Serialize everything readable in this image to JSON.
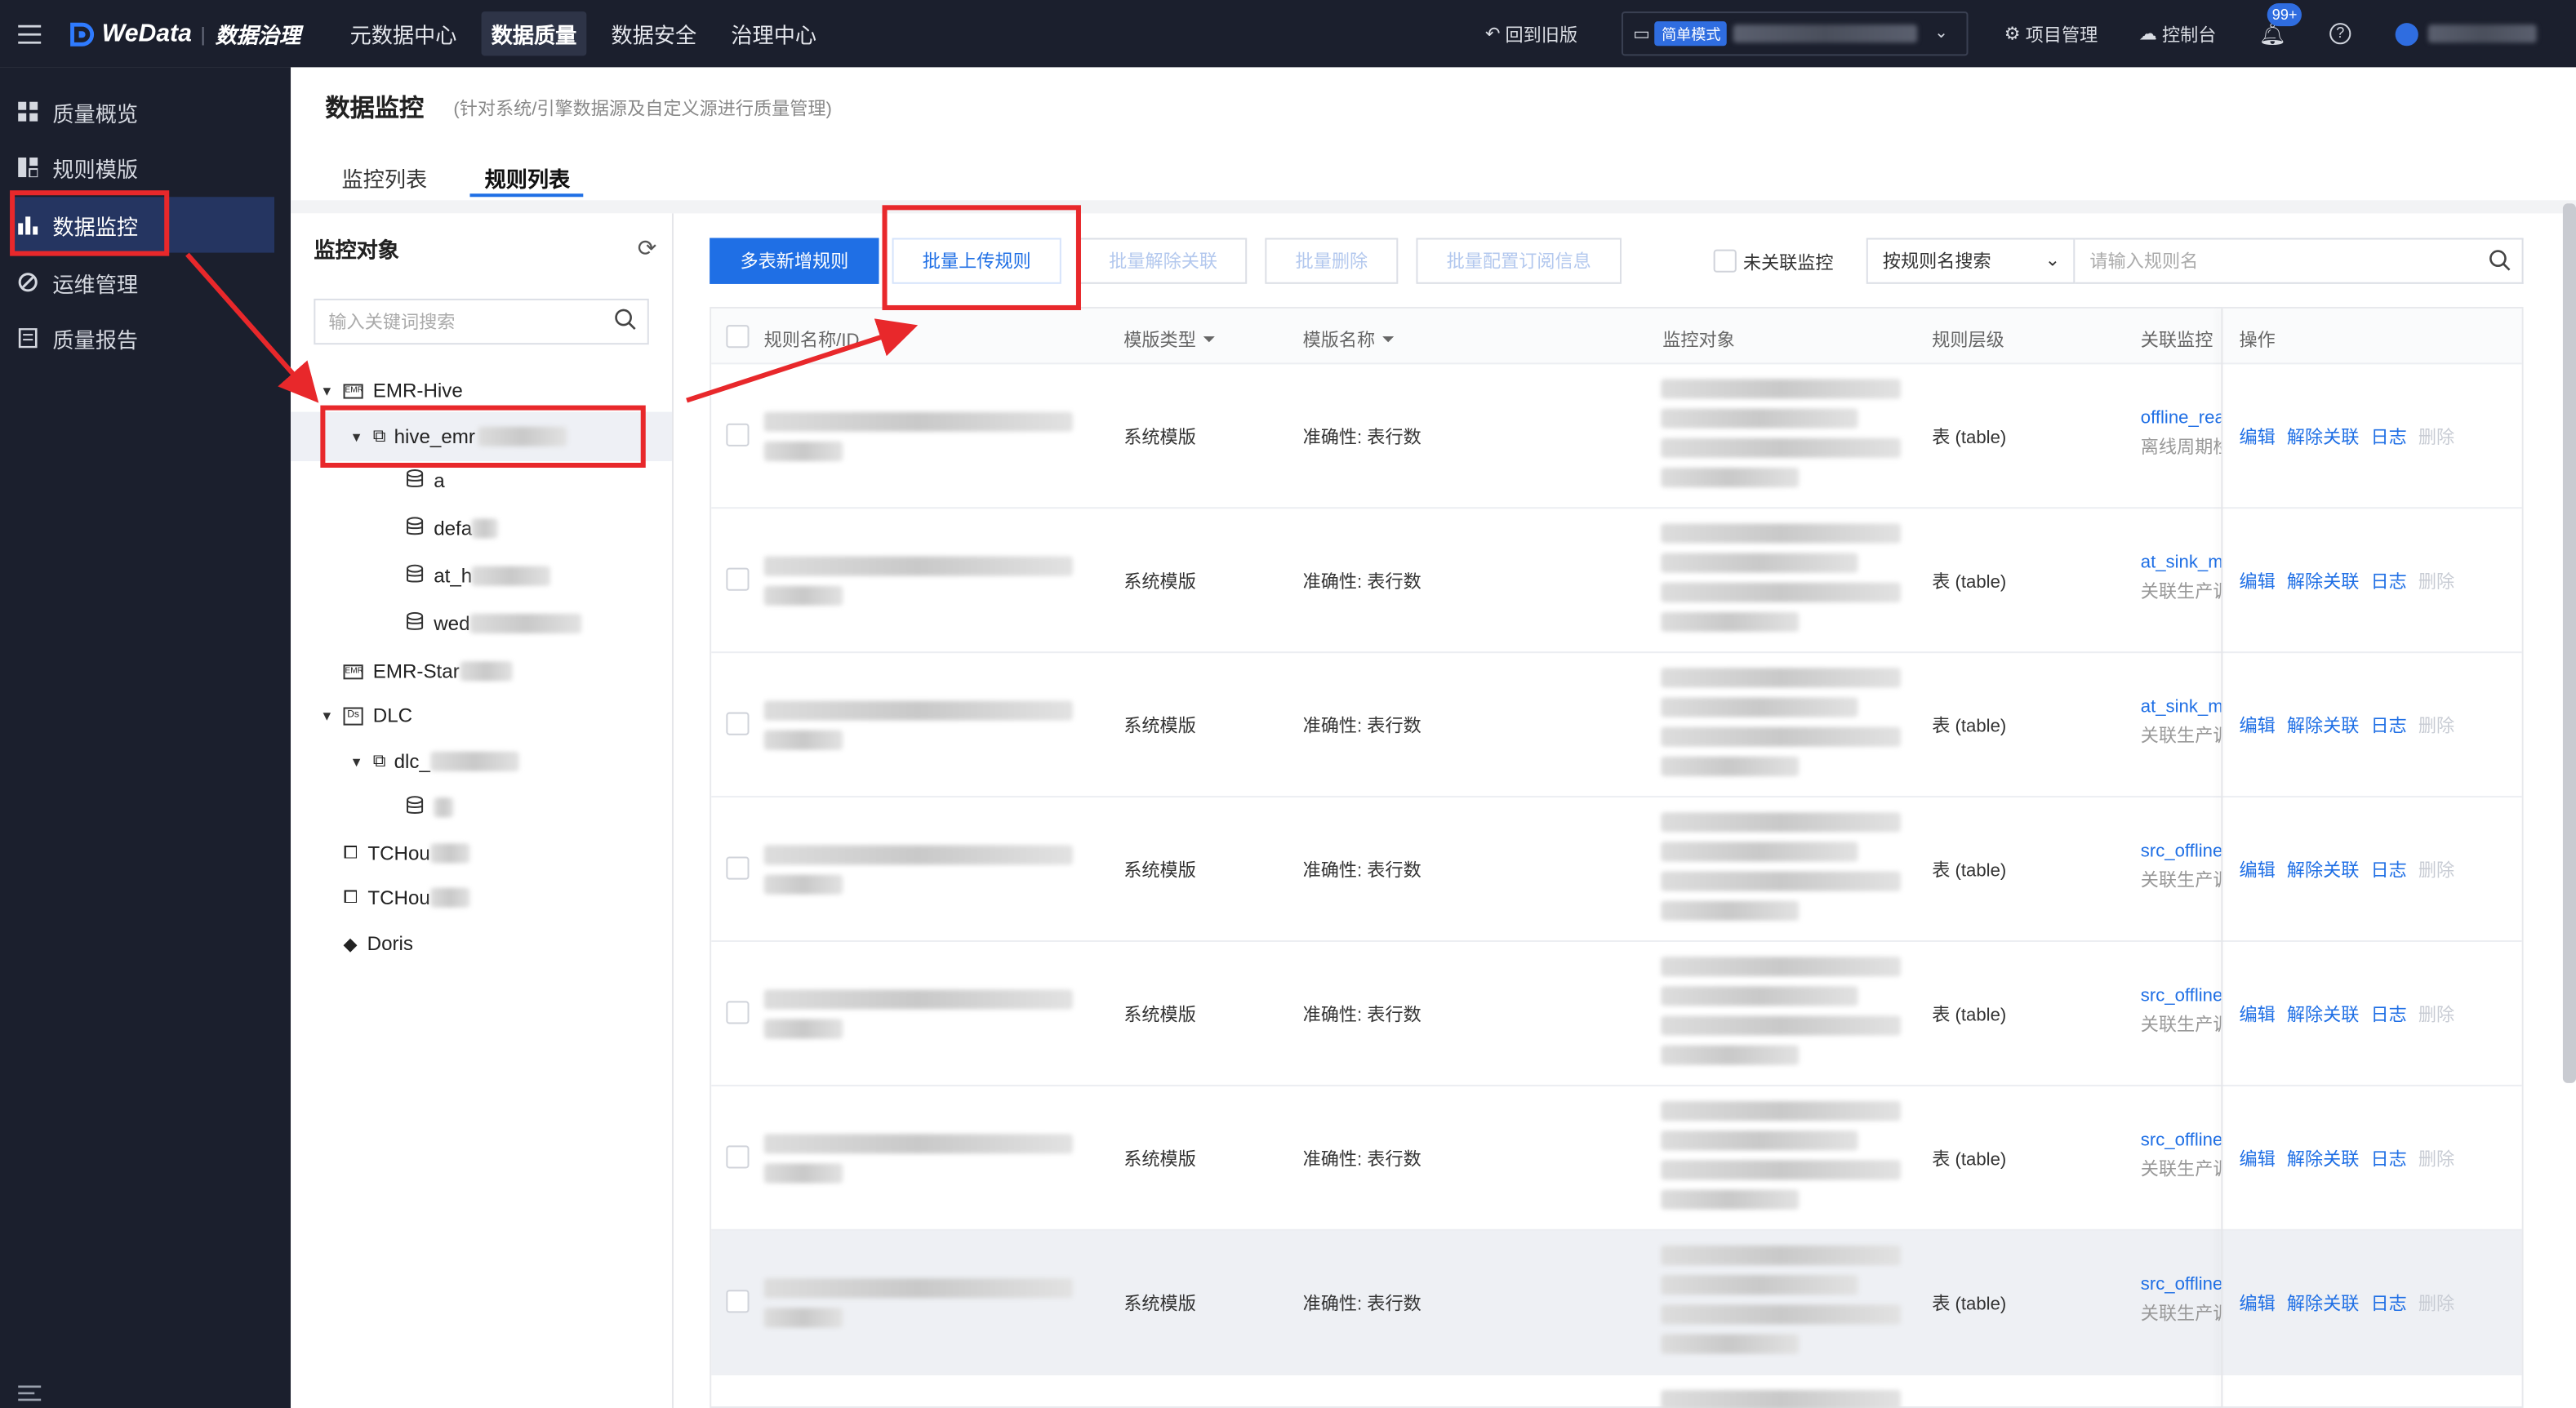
{
  "topbar": {
    "logo_text": "WeData",
    "product": "数据治理",
    "nav": [
      "元数据中心",
      "数据质量",
      "数据安全",
      "治理中心"
    ],
    "back_old": "回到旧版",
    "mode_badge": "简单模式",
    "project_mgmt": "项目管理",
    "console": "控制台",
    "notif_count": "99+"
  },
  "sidebar": {
    "items": [
      "质量概览",
      "规则模版",
      "数据监控",
      "运维管理",
      "质量报告"
    ]
  },
  "page": {
    "title": "数据监控",
    "subtitle": "(针对系统/引擎数据源及自定义源进行质量管理)",
    "tabs": [
      "监控列表",
      "规则列表"
    ]
  },
  "left_panel": {
    "title": "监控对象",
    "search_placeholder": "输入关键词搜索",
    "tree": {
      "emr_hive": "EMR-Hive",
      "hive_emr": "hive_emr",
      "db_a": "a",
      "db_defa": "defa",
      "db_at_h": "at_h",
      "db_wed": "wed",
      "emr_star": "EMR-Star",
      "dlc": "DLC",
      "dlc_child": "dlc_",
      "tchou1": "TCHou",
      "tchou2": "TCHou",
      "doris": "Doris"
    }
  },
  "toolbar": {
    "multi_add": "多表新增规则",
    "batch_upload": "批量上传规则",
    "batch_unlink": "批量解除关联",
    "batch_delete": "批量删除",
    "batch_subscribe": "批量配置订阅信息",
    "unlinked_label": "未关联监控",
    "search_by": "按规则名搜索",
    "search_placeholder": "请输入规则名"
  },
  "table": {
    "headers": {
      "rule_name": "规则名称/ID",
      "template_type": "模版类型",
      "template_name": "模版名称",
      "monitor_object": "监控对象",
      "rule_level": "规则层级",
      "linked_monitor": "关联监控",
      "ops": "操作"
    },
    "rows": [
      {
        "template_type": "系统模版",
        "template_name": "准确性: 表行数",
        "rule_level": "表 (table)",
        "monitor_link": "offline_rea",
        "monitor_sub": "离线周期检"
      },
      {
        "template_type": "系统模版",
        "template_name": "准确性: 表行数",
        "rule_level": "表 (table)",
        "monitor_link": "at_sink_m",
        "monitor_sub": "关联生产调"
      },
      {
        "template_type": "系统模版",
        "template_name": "准确性: 表行数",
        "rule_level": "表 (table)",
        "monitor_link": "at_sink_m",
        "monitor_sub": "关联生产调"
      },
      {
        "template_type": "系统模版",
        "template_name": "准确性: 表行数",
        "rule_level": "表 (table)",
        "monitor_link": "src_offline",
        "monitor_sub": "关联生产调"
      },
      {
        "template_type": "系统模版",
        "template_name": "准确性: 表行数",
        "rule_level": "表 (table)",
        "monitor_link": "src_offline",
        "monitor_sub": "关联生产调"
      },
      {
        "template_type": "系统模版",
        "template_name": "准确性: 表行数",
        "rule_level": "表 (table)",
        "monitor_link": "src_offline",
        "monitor_sub": "关联生产调"
      },
      {
        "template_type": "系统模版",
        "template_name": "准确性: 表行数",
        "rule_level": "表 (table)",
        "monitor_link": "src_offline",
        "monitor_sub": "关联生产调"
      }
    ],
    "ops": {
      "edit": "编辑",
      "unlink": "解除关联",
      "log": "日志",
      "delete": "删除"
    }
  },
  "colors": {
    "primary": "#1f6fe5",
    "topbar": "#1b1f2d",
    "annotation": "#e8282b"
  }
}
